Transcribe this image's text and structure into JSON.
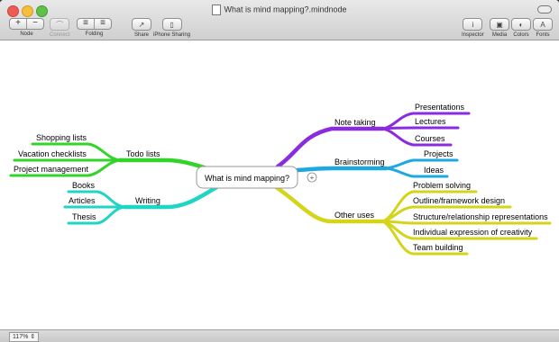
{
  "window": {
    "title": "What is mind mapping?.mindnode"
  },
  "toolbar": {
    "node_label": "Node",
    "node_add": "+",
    "node_remove": "−",
    "connect_label": "Connect",
    "folding_label": "Folding",
    "share_label": "Share",
    "iphone_label": "iPhone Sharing",
    "inspector_label": "Inspector",
    "media_label": "Media",
    "colors_label": "Colors",
    "fonts_label": "Fonts"
  },
  "statusbar": {
    "zoom": "117%"
  },
  "mindmap": {
    "central": "What is mind mapping?",
    "plus": "+",
    "branches": {
      "note_taking": {
        "label": "Note taking",
        "color": "#8a2be2",
        "children": [
          "Presentations",
          "Lectures",
          "Courses"
        ]
      },
      "brainstorming": {
        "label": "Brainstorming",
        "color": "#1ea7e1",
        "children": [
          "Projects",
          "Ideas"
        ]
      },
      "other_uses": {
        "label": "Other uses",
        "color": "#d4d41a",
        "children": [
          "Problem solving",
          "Outline/framework design",
          "Structure/relationship representations",
          "Individual expression of creativity",
          "Team building"
        ]
      },
      "todo": {
        "label": "Todo lists",
        "color": "#32d42a",
        "children": [
          "Shopping lists",
          "Vacation checklists",
          "Project management"
        ]
      },
      "writing": {
        "label": "Writing",
        "color": "#1fd6c4",
        "children": [
          "Books",
          "Articles",
          "Thesis"
        ]
      }
    }
  }
}
